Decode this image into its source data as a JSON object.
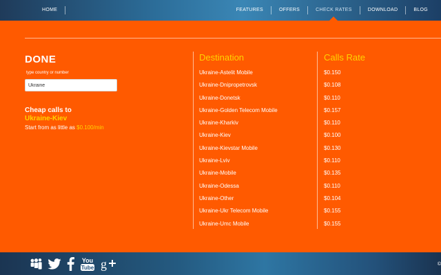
{
  "nav": {
    "left": [
      {
        "label": "HOME"
      }
    ],
    "right": [
      {
        "label": "FEATURES"
      },
      {
        "label": "OFFERS"
      },
      {
        "label": "CHECK RATES"
      },
      {
        "label": "DOWNLOAD"
      },
      {
        "label": "BLOG"
      }
    ]
  },
  "search": {
    "title": "DONE",
    "hint": "type country or number",
    "value": "Ukraine"
  },
  "promo": {
    "title": "Cheap calls to",
    "city": "Ukraine-Kiev",
    "prefix": "Start from as little as",
    "price": "$0.100/min"
  },
  "table": {
    "destination_header": "Destination",
    "rate_header": "Calls Rate",
    "rows": [
      {
        "destination": "Ukraine-Astelit Mobile",
        "rate": "$0.150"
      },
      {
        "destination": "Ukraine-Dnipropetrovsk",
        "rate": "$0.108"
      },
      {
        "destination": "Ukraine-Donetsk",
        "rate": "$0.110"
      },
      {
        "destination": "Ukraine-Golden Telecom Mobile",
        "rate": "$0.157"
      },
      {
        "destination": "Ukraine-Kharkiv",
        "rate": "$0.110"
      },
      {
        "destination": "Ukraine-Kiev",
        "rate": "$0.100"
      },
      {
        "destination": "Ukraine-Kievstar Mobile",
        "rate": "$0.130"
      },
      {
        "destination": "Ukraine-Lviv",
        "rate": "$0.110"
      },
      {
        "destination": "Ukraine-Mobile",
        "rate": "$0.135"
      },
      {
        "destination": "Ukraine-Odessa",
        "rate": "$0.110"
      },
      {
        "destination": "Ukraine-Other",
        "rate": "$0.104"
      },
      {
        "destination": "Ukraine-Ukr Telecom Mobile",
        "rate": "$0.155"
      },
      {
        "destination": "Ukraine-Umc Mobile",
        "rate": "$0.155"
      }
    ]
  },
  "footer": {
    "social": [
      {
        "icon": "myspace-icon"
      },
      {
        "icon": "twitter-icon"
      },
      {
        "icon": "facebook-icon"
      },
      {
        "icon": "youtube-icon"
      },
      {
        "icon": "google-plus-icon"
      }
    ],
    "copyright": "©"
  },
  "colors": {
    "accent": "#ff5a00",
    "highlight": "#ffd400",
    "nav": "#2c6d99"
  }
}
